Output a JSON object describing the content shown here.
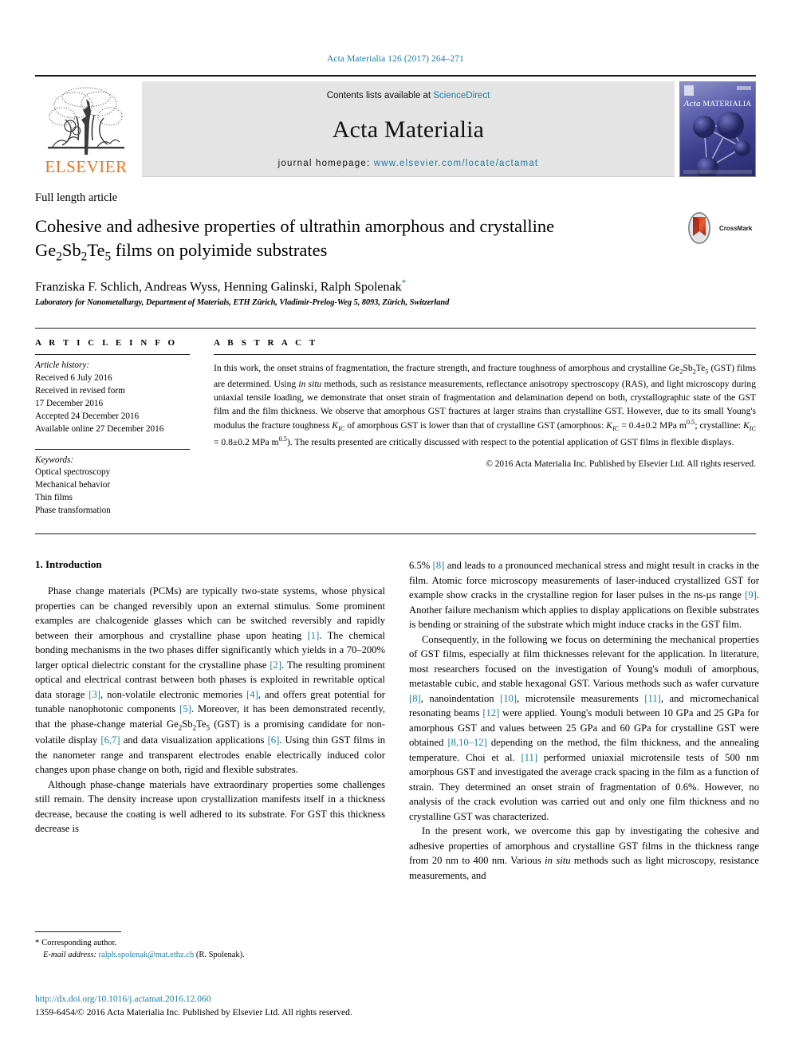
{
  "running_head": "Acta Materialia 126 (2017) 264–271",
  "masthead": {
    "publisher_name": "ELSEVIER",
    "contents_prefix": "Contents lists available at ",
    "contents_link": "ScienceDirect",
    "journal_name": "Acta Materialia",
    "homepage_prefix": "journal homepage: ",
    "homepage_url": "www.elsevier.com/locate/actamat",
    "cover_title_italic": "Acta",
    "cover_title_rest": "MATERIALIA"
  },
  "article": {
    "type": "Full length article",
    "title_part1": "Cohesive and adhesive properties of ultrathin amorphous and crystalline Ge",
    "title_sub1": "2",
    "title_part2": "Sb",
    "title_sub2": "2",
    "title_part3": "Te",
    "title_sub3": "5",
    "title_part4": " films on polyimide substrates",
    "title_plain": "Cohesive and adhesive properties of ultrathin amorphous and crystalline Ge2Sb2Te5 films on polyimide substrates",
    "authors": "Franziska F. Schlich, Andreas Wyss, Henning Galinski, Ralph Spolenak",
    "author_marker": "*",
    "affiliation": "Laboratory for Nanometallurgy, Department of Materials, ETH Zürich, Vladimir-Prelog-Weg 5, 8093, Zürich, Switzerland",
    "crossmark_label": "CrossMark"
  },
  "article_info": {
    "heading": "A R T I C L E   I N F O",
    "history_label": "Article history:",
    "history": [
      "Received 6 July 2016",
      "Received in revised form",
      "17 December 2016",
      "Accepted 24 December 2016",
      "Available online 27 December 2016"
    ],
    "keywords_label": "Keywords:",
    "keywords": [
      "Optical spectroscopy",
      "Mechanical behavior",
      "Thin films",
      "Phase transformation"
    ]
  },
  "abstract": {
    "heading": "A B S T R A C T",
    "text_p1": "In this work, the onset strains of fragmentation, the fracture strength, and fracture toughness of amorphous and crystalline Ge2Sb2Te5 (GST) films are determined. Using in situ methods, such as resistance measurements, reflectance anisotropy spectroscopy (RAS), and light microscopy during uniaxial tensile loading, we demonstrate that onset strain of fragmentation and delamination depend on both, crystallographic state of the GST film and the film thickness. We observe that amorphous GST fractures at larger strains than crystalline GST. However, due to its small Young's modulus the fracture toughness KIC of amorphous GST is lower than that of crystalline GST (amorphous: KIC = 0.4±0.2 MPa m0.5; crystalline: KIC = 0.8±0.2 MPa m0.5). The results presented are critically discussed with respect to the potential application of GST films in flexible displays.",
    "copyright": "© 2016 Acta Materialia Inc. Published by Elsevier Ltd. All rights reserved."
  },
  "body": {
    "section_number_title": "1. Introduction",
    "left_paragraphs": [
      "Phase change materials (PCMs) are typically two-state systems, whose physical properties can be changed reversibly upon an external stimulus. Some prominent examples are chalcogenide glasses which can be switched reversibly and rapidly between their amorphous and crystalline phase upon heating [1]. The chemical bonding mechanisms in the two phases differ significantly which yields in a 70–200% larger optical dielectric constant for the crystalline phase [2]. The resulting prominent optical and electrical contrast between both phases is exploited in rewritable optical data storage [3], non-volatile electronic memories [4], and offers great potential for tunable nanophotonic components [5]. Moreover, it has been demonstrated recently, that the phase-change material Ge2Sb2Te5 (GST) is a promising candidate for non-volatile display [6,7] and data visualization applications [6]. Using thin GST films in the nanometer range and transparent electrodes enable electrically induced color changes upon phase change on both, rigid and flexible substrates.",
      "Although phase-change materials have extraordinary properties some challenges still remain. The density increase upon crystallization manifests itself in a thickness decrease, because the coating is well adhered to its substrate. For GST this thickness decrease is"
    ],
    "right_paragraphs": [
      "6.5% [8] and leads to a pronounced mechanical stress and might result in cracks in the film. Atomic force microscopy measurements of laser-induced crystallized GST for example show cracks in the crystalline region for laser pulses in the ns-µs range [9]. Another failure mechanism which applies to display applications on flexible substrates is bending or straining of the substrate which might induce cracks in the GST film.",
      "Consequently, in the following we focus on determining the mechanical properties of GST films, especially at film thicknesses relevant for the application. In literature, most researchers focused on the investigation of Young's moduli of amorphous, metastable cubic, and stable hexagonal GST. Various methods such as wafer curvature [8], nanoindentation [10], microtensile measurements [11], and micromechanical resonating beams [12] were applied. Young's moduli between 10 GPa and 25 GPa for amorphous GST and values between 25 GPa and 60 GPa for crystalline GST were obtained [8,10–12] depending on the method, the film thickness, and the annealing temperature. Choi et al. [11] performed uniaxial microtensile tests of 500 nm amorphous GST and investigated the average crack spacing in the film as a function of strain. They determined an onset strain of fragmentation of 0.6%. However, no analysis of the crack evolution was carried out and only one film thickness and no crystalline GST was characterized.",
      "In the present work, we overcome this gap by investigating the cohesive and adhesive properties of amorphous and crystalline GST films in the thickness range from 20 nm to 400 nm. Various in situ methods such as light microscopy, resistance measurements, and"
    ]
  },
  "footnote": {
    "star": "*",
    "corresponding": "Corresponding author.",
    "email_label": "E-mail address:",
    "email": "ralph.spolenak@mat.ethz.ch",
    "email_suffix": "(R. Spolenak)."
  },
  "page_footer": {
    "doi": "http://dx.doi.org/10.1016/j.actamat.2016.12.060",
    "issn_copyright": "1359-6454/© 2016 Acta Materialia Inc. Published by Elsevier Ltd. All rights reserved."
  },
  "colors": {
    "link": "#1a7fa8",
    "elsevier_orange": "#E87722",
    "band_gray": "#e4e4e4"
  }
}
